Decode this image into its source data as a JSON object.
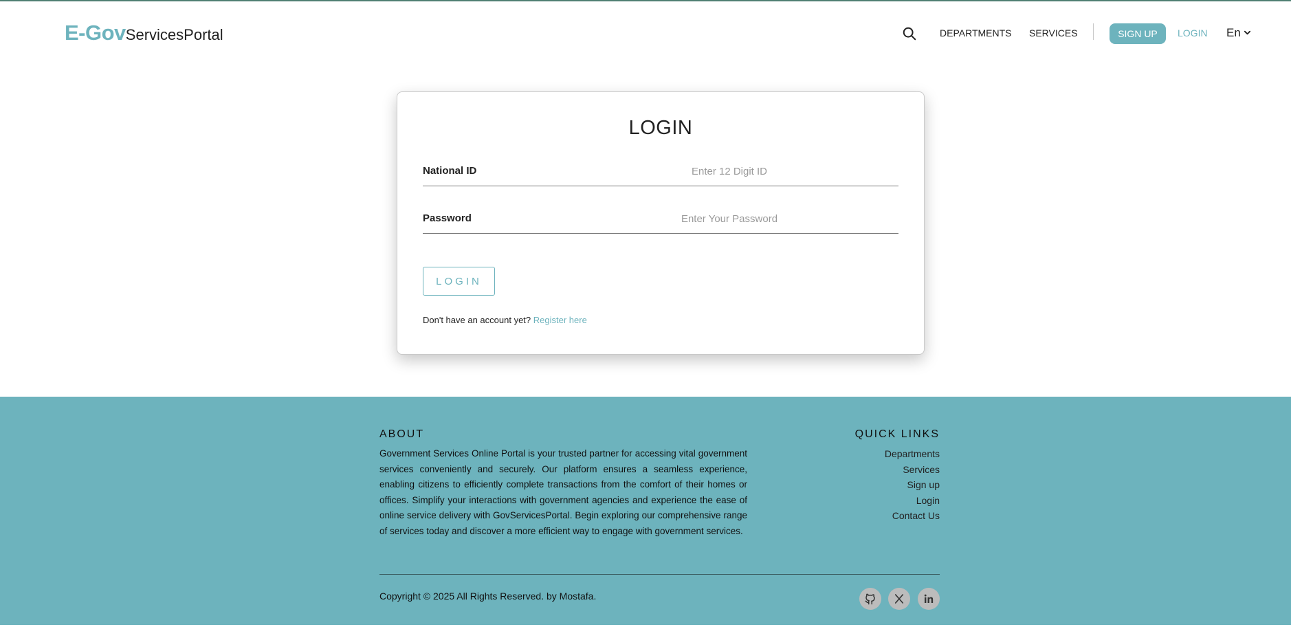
{
  "header": {
    "logo_primary": "E-Gov",
    "logo_secondary": "ServicesPortal",
    "nav": {
      "departments": "DEPARTMENTS",
      "services": "SERVICES",
      "signup": "SIGN UP",
      "login": "LOGIN",
      "language": "En"
    }
  },
  "login_card": {
    "title": "LOGIN",
    "national_id_label": "National ID",
    "national_id_placeholder": "Enter 12 Digit ID",
    "national_id_value": "",
    "password_label": "Password",
    "password_placeholder": "Enter Your Password",
    "password_value": "",
    "submit_label": "LOGIN",
    "register_prompt": "Don't have an account yet?",
    "register_link": "Register here"
  },
  "footer": {
    "about_title": "ABOUT",
    "about_text": "Government Services Online Portal is your trusted partner for accessing vital government services conveniently and securely. Our platform ensures a seamless experience, enabling citizens to efficiently complete transactions from the comfort of their homes or offices. Simplify your interactions with government agencies and experience the ease of online service delivery with GovServicesPortal. Begin exploring our comprehensive range of services today and discover a more efficient way to engage with government services.",
    "quick_links_title": "QUICK LINKS",
    "quick_links": [
      "Departments",
      "Services",
      "Sign up",
      "Login",
      "Contact Us"
    ],
    "copyright": "Copyright © 2025 All Rights Reserved. by Mostafa.",
    "social_icons": [
      "github-icon",
      "x-twitter-icon",
      "linkedin-icon"
    ]
  },
  "colors": {
    "accent": "#6db3bd",
    "footer_bg": "#6db3bd",
    "top_line": "#4f7f73",
    "text": "#222222"
  }
}
